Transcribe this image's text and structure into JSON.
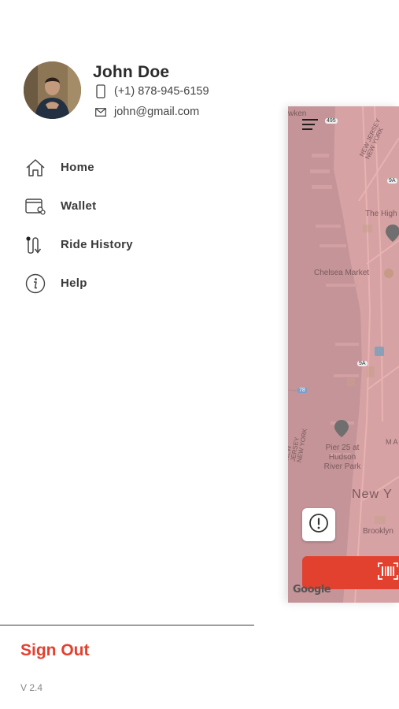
{
  "profile": {
    "name": "John Doe",
    "phone": "(+1) 878-945-6159",
    "email": "john@gmail.com"
  },
  "menu": {
    "items": [
      {
        "label": "Home",
        "icon": "home-icon"
      },
      {
        "label": "Wallet",
        "icon": "wallet-icon"
      },
      {
        "label": "Ride History",
        "icon": "route-icon"
      },
      {
        "label": "Help",
        "icon": "info-icon"
      }
    ]
  },
  "footer": {
    "sign_out": "Sign Out",
    "version": "V 2.4"
  },
  "map": {
    "labels": {
      "weehawken": "wken",
      "nj_ny_top": "NEW JERSEY NEW YORK",
      "high_line": "The High",
      "chelsea": "Chelsea Market",
      "nj_ny_bottom": "NEW JERSEY NEW YORK",
      "pier": "Pier 25 at Hudson River Park",
      "new_york": "New Y",
      "brooklyn": "Brooklyn",
      "route_495": "495",
      "route_9a_top": "9A",
      "route_9a_mid": "9A",
      "route_78": "78",
      "ma": "M A",
      "google": "Google"
    }
  },
  "colors": {
    "accent": "#e53f2e",
    "map_bg": "#d6a2a4",
    "scan_button": "#e3412f"
  }
}
